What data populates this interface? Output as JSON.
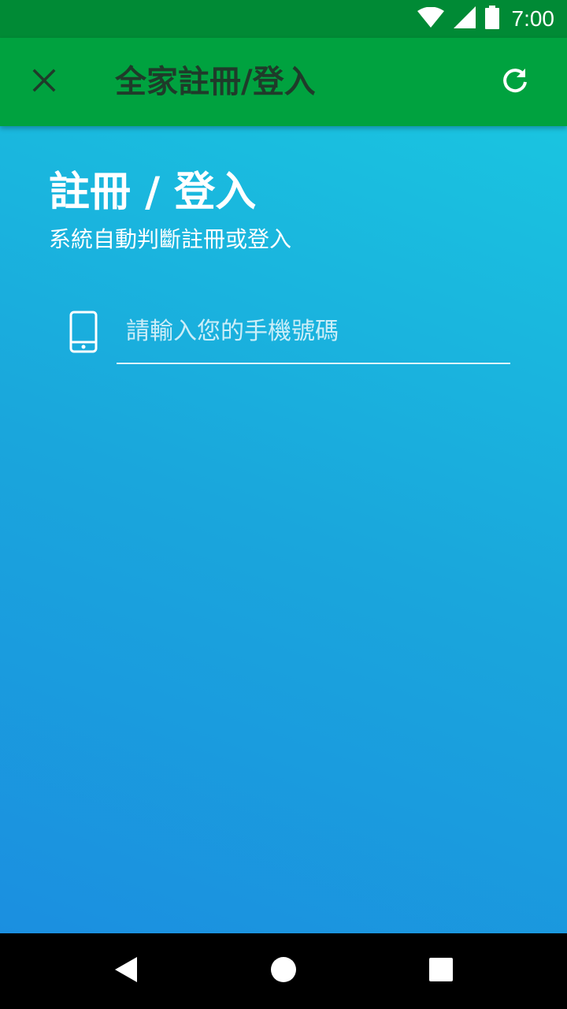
{
  "status_bar": {
    "time": "7:00",
    "icons": [
      "wifi-icon",
      "signal-icon",
      "battery-icon"
    ]
  },
  "app_bar": {
    "title": "全家註冊/登入",
    "close_icon": "close-icon",
    "refresh_icon": "refresh-icon",
    "color": "#00a23f"
  },
  "main": {
    "heading": "註冊 / 登入",
    "subheading": "系統自動判斷註冊或登入",
    "phone_input": {
      "placeholder": "請輸入您的手機號碼",
      "value": "",
      "icon": "smartphone-icon"
    }
  },
  "nav_bar": {
    "buttons": [
      "back-icon",
      "home-icon",
      "recents-icon"
    ]
  },
  "colors": {
    "status_bar": "#008a35",
    "app_bar": "#00a23f",
    "title_text": "#1f3b2a",
    "background_gradient_start": "#1b8fe0",
    "background_gradient_end": "#1ac4e0"
  }
}
